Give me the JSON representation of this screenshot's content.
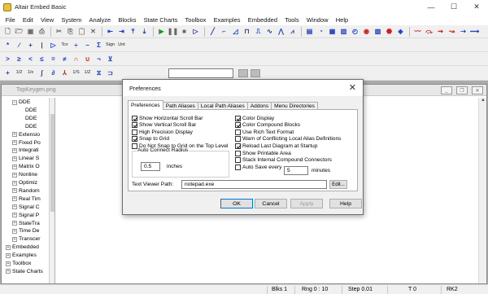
{
  "window": {
    "title": "Altair Embed Basic"
  },
  "menu": [
    "File",
    "Edit",
    "View",
    "System",
    "Analyze",
    "Blocks",
    "State Charts",
    "Toolbox",
    "Examples",
    "Embedded",
    "Tools",
    "Window",
    "Help"
  ],
  "toolbar3": {
    "a": "+",
    "b": "1/2",
    "c": "1/x",
    "d": "∫",
    "e": "1/S",
    "f": "1/Z"
  },
  "child_window": {
    "title": "TopKeygen.png"
  },
  "tree": [
    {
      "indent": 1,
      "box": "-",
      "label": "DDE"
    },
    {
      "indent": 2,
      "box": "",
      "label": "DDE"
    },
    {
      "indent": 2,
      "box": "",
      "label": "DDE"
    },
    {
      "indent": 2,
      "box": "",
      "label": "DDE"
    },
    {
      "indent": 1,
      "box": "+",
      "label": "Extensio"
    },
    {
      "indent": 1,
      "box": "+",
      "label": "Fixed Po"
    },
    {
      "indent": 1,
      "box": "+",
      "label": "Integrati"
    },
    {
      "indent": 1,
      "box": "+",
      "label": "Linear S"
    },
    {
      "indent": 1,
      "box": "+",
      "label": "Matrix O"
    },
    {
      "indent": 1,
      "box": "+",
      "label": "Nonline"
    },
    {
      "indent": 1,
      "box": "+",
      "label": "Optimiz"
    },
    {
      "indent": 1,
      "box": "+",
      "label": "Random"
    },
    {
      "indent": 1,
      "box": "+",
      "label": "Real Tim"
    },
    {
      "indent": 1,
      "box": "+",
      "label": "Signal C"
    },
    {
      "indent": 1,
      "box": "+",
      "label": "Signal P"
    },
    {
      "indent": 1,
      "box": "+",
      "label": "StateTra"
    },
    {
      "indent": 1,
      "box": "+",
      "label": "Time De"
    },
    {
      "indent": 1,
      "box": "+",
      "label": "Transcer"
    },
    {
      "indent": 0,
      "box": "+",
      "label": "Embedded"
    },
    {
      "indent": 0,
      "box": "+",
      "label": "Examples"
    },
    {
      "indent": 0,
      "box": "+",
      "label": "Toolbox"
    },
    {
      "indent": 0,
      "box": "+",
      "label": "State Charts"
    }
  ],
  "status": {
    "blks": "Blks 1",
    "rng": "Rng 0 : 10",
    "step": "Step 0.01",
    "t": "T 0",
    "rk": "RK2"
  },
  "dialog": {
    "title": "Preferences",
    "tabs": [
      "Preferences",
      "Path Aliases",
      "Local Path Aliases",
      "Addons",
      "Menu Directories"
    ],
    "left_checks": [
      {
        "label": "Show Horizontal Scroll Bar",
        "checked": true
      },
      {
        "label": "Show Vertical Scroll Bar",
        "checked": true
      },
      {
        "label": "High Precision Display",
        "checked": false
      },
      {
        "label": "Snap to Grid",
        "checked": true
      },
      {
        "label": "Do Not Snap to Grid on the Top Level",
        "checked": false
      }
    ],
    "right_checks": [
      {
        "label": "Color Display",
        "checked": true
      },
      {
        "label": "Color Compound Blocks",
        "checked": true
      },
      {
        "label": "Use Rich Text Format",
        "checked": false
      },
      {
        "label": "Warn of Conflicting Local Alias Definitions",
        "checked": false
      },
      {
        "label": "Reload Last Diagram at Startup",
        "checked": true
      },
      {
        "label": "Show Printable Area",
        "checked": false
      },
      {
        "label": "Stack Internal Compound Connectors",
        "checked": false
      },
      {
        "label": "Auto Save every",
        "checked": false
      }
    ],
    "auto_connect": {
      "legend": "Auto Connect Radius",
      "value": "0.5",
      "unit": "inches"
    },
    "auto_save": {
      "value": "5",
      "unit": "minutes"
    },
    "text_viewer": {
      "label": "Text Viewer Path:",
      "value": "notepad.exe",
      "edit": "Edit..."
    },
    "buttons": {
      "ok": "OK",
      "cancel": "Cancel",
      "apply": "Apply",
      "help": "Help"
    }
  }
}
